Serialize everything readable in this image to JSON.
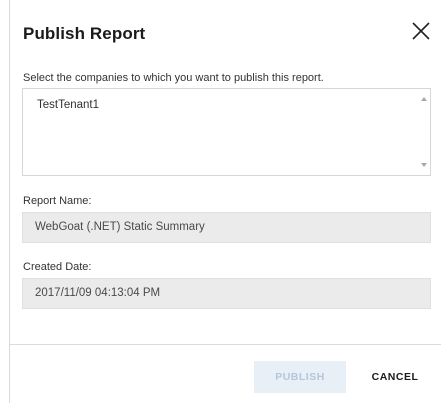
{
  "dialog": {
    "title": "Publish Report",
    "close_icon": "close-icon",
    "select_label": "Select the companies to which you want to publish this report.",
    "companies": [
      "TestTenant1"
    ],
    "report_name_label": "Report Name:",
    "report_name_value": "WebGoat (.NET) Static Summary",
    "created_date_label": "Created Date:",
    "created_date_value": "2017/11/09 04:13:04 PM",
    "publish_label": "PUBLISH",
    "cancel_label": "CANCEL",
    "publish_enabled": false
  },
  "colors": {
    "publish_bg_disabled": "#e9eff6",
    "publish_text_disabled": "#b4c7db",
    "readonly_field_bg": "#ebebeb"
  }
}
